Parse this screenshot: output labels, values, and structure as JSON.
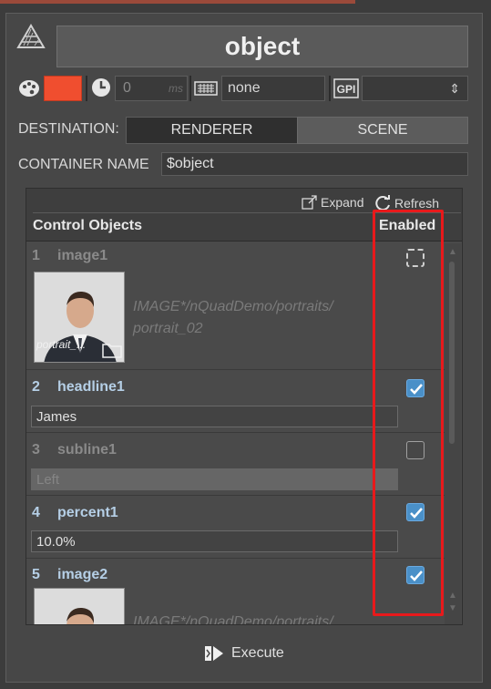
{
  "header": {
    "title": "object",
    "title_icon": "gem-icon",
    "color_swatch": "#f04e2f",
    "time_value": "0",
    "time_unit": "ms",
    "keyboard_field": "none",
    "gpi_label": "GPI",
    "gpi_selected": ""
  },
  "destination": {
    "label": "DESTINATION:",
    "options": [
      "RENDERER",
      "SCENE"
    ],
    "selected": "RENDERER"
  },
  "container": {
    "label": "CONTAINER NAME",
    "value": "$object"
  },
  "panel": {
    "expand_label": "Expand",
    "refresh_label": "Refresh",
    "col_left": "Control Objects",
    "col_right": "Enabled"
  },
  "items": [
    {
      "num": "1",
      "name": "image1",
      "kind": "image",
      "thumb_label": "portrait_...",
      "path": "IMAGE*/nQuadDemo/portraits/portrait_02",
      "path_line1": "IMAGE*/nQuadDemo/portraits/",
      "path_line2": "portrait_02",
      "enabled": "indeterminate"
    },
    {
      "num": "2",
      "name": "headline1",
      "kind": "text",
      "value": "James",
      "enabled": true
    },
    {
      "num": "3",
      "name": "subline1",
      "kind": "text",
      "value": "Left",
      "enabled": false
    },
    {
      "num": "4",
      "name": "percent1",
      "kind": "text",
      "value": "10.0%",
      "enabled": true
    },
    {
      "num": "5",
      "name": "image2",
      "kind": "image",
      "path_partial": "IMAGE*/nQuadDemo/portraits/",
      "enabled": true
    }
  ],
  "footer": {
    "execute_label": "Execute"
  },
  "colors": {
    "accent_blue": "#4a90c8",
    "highlight_red": "#e8191b",
    "background": "#474747"
  }
}
